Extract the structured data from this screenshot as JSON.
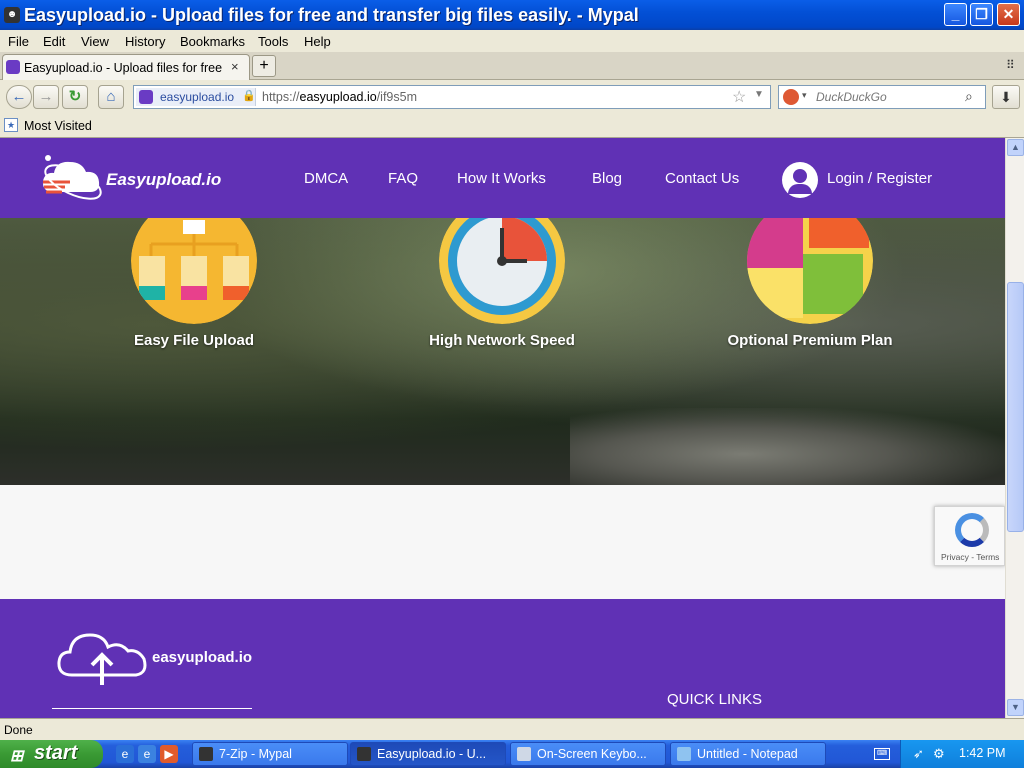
{
  "window": {
    "title": "Easyupload.io - Upload files for free and transfer big files easily. - Mypal",
    "buttons": {
      "minimize": "_",
      "maximize": "❐",
      "close": "✕"
    }
  },
  "menu": [
    "File",
    "Edit",
    "View",
    "History",
    "Bookmarks",
    "Tools",
    "Help"
  ],
  "tabs": [
    {
      "label": "Easyupload.io - Upload files for free ..."
    }
  ],
  "tab_close": "×",
  "new_tab": "+",
  "tab_list": "⠿",
  "nav": {
    "back": "←",
    "forward": "→",
    "reload": "↻",
    "home": "⌂",
    "identity_domain": "easyupload.io",
    "url_prefix": "https://",
    "url_host": "easyupload.io",
    "url_path": "/if9s5m",
    "search_placeholder": "DuckDuckGo",
    "download": "⬇"
  },
  "bookmarks": [
    {
      "label": "Most Visited"
    }
  ],
  "site": {
    "logo": "Easyupload.io",
    "nav_links": [
      "DMCA",
      "FAQ",
      "How It Works",
      "Blog",
      "Contact Us"
    ],
    "login": "Login / Register",
    "features": [
      {
        "label": "Easy File Upload",
        "icon": "file-tree-icon"
      },
      {
        "label": "High Network Speed",
        "icon": "clock-icon"
      },
      {
        "label": "Optional Premium Plan",
        "icon": "puzzle-icon"
      }
    ],
    "footer_logo": "easyupload.io",
    "quick_links": "QUICK LINKS",
    "recaptcha_terms": "Privacy - Terms"
  },
  "status": "Done",
  "taskbar": {
    "start": "start",
    "tasks": [
      {
        "label": "7-Zip - Mypal"
      },
      {
        "label": "Easyupload.io - U..."
      },
      {
        "label": "On-Screen Keybo..."
      },
      {
        "label": "Untitled - Notepad"
      }
    ],
    "clock": "1:42 PM"
  },
  "colors": {
    "brand_purple": "#6031b5",
    "xp_blue": "#245edb"
  }
}
